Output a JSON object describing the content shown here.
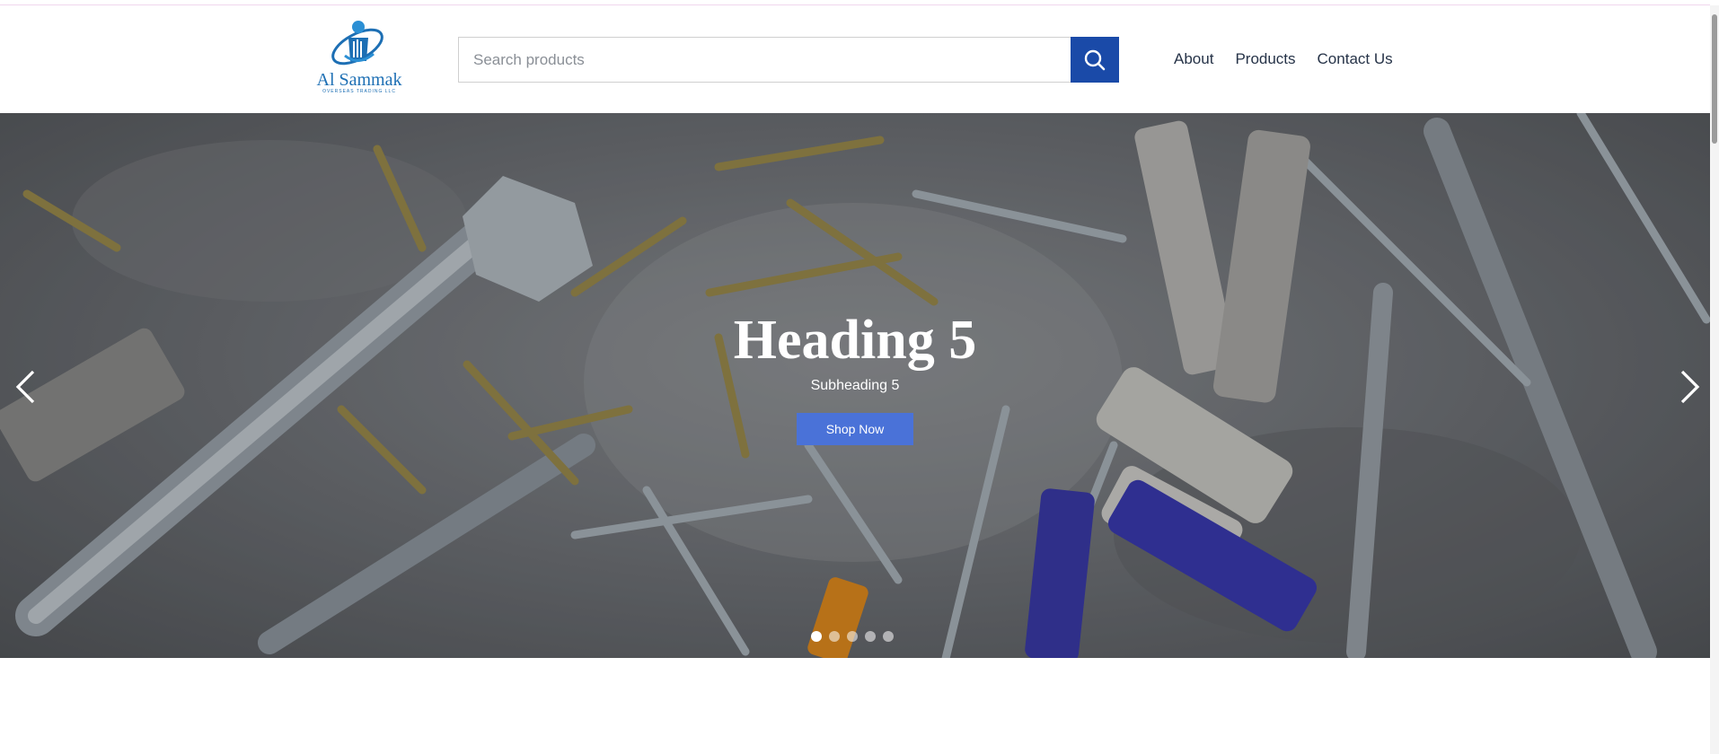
{
  "header": {
    "logo": {
      "name": "Al Sammak",
      "tagline": "OVERSEAS TRADING LLC"
    },
    "search": {
      "placeholder": "Search products",
      "button_icon": "search-icon"
    },
    "nav": [
      {
        "label": "About"
      },
      {
        "label": "Products"
      },
      {
        "label": "Contact Us"
      }
    ]
  },
  "hero": {
    "heading": "Heading 5",
    "subheading": "Subheading 5",
    "button_label": "Shop Now",
    "active_slide": 1,
    "slide_count": 5,
    "prev_icon": "chevron-left-icon",
    "next_icon": "chevron-right-icon"
  },
  "colors": {
    "brand_blue": "#1d6fb4",
    "search_button": "#1a4aa8",
    "shop_button": "#4a72d8",
    "nav_text": "#263348"
  }
}
